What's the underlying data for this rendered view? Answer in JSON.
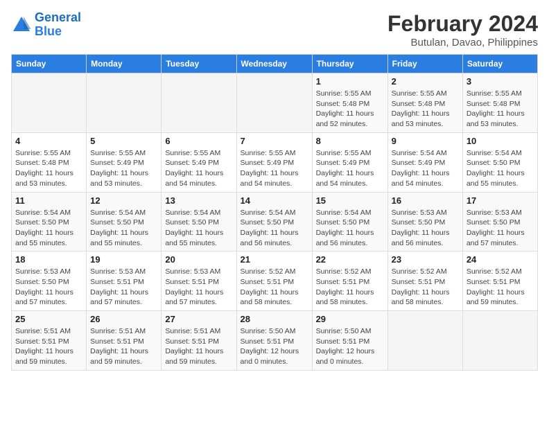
{
  "header": {
    "logo_line1": "General",
    "logo_line2": "Blue",
    "month_year": "February 2024",
    "location": "Butulan, Davao, Philippines"
  },
  "weekdays": [
    "Sunday",
    "Monday",
    "Tuesday",
    "Wednesday",
    "Thursday",
    "Friday",
    "Saturday"
  ],
  "weeks": [
    [
      {
        "day": "",
        "detail": ""
      },
      {
        "day": "",
        "detail": ""
      },
      {
        "day": "",
        "detail": ""
      },
      {
        "day": "",
        "detail": ""
      },
      {
        "day": "1",
        "detail": "Sunrise: 5:55 AM\nSunset: 5:48 PM\nDaylight: 11 hours\nand 52 minutes."
      },
      {
        "day": "2",
        "detail": "Sunrise: 5:55 AM\nSunset: 5:48 PM\nDaylight: 11 hours\nand 53 minutes."
      },
      {
        "day": "3",
        "detail": "Sunrise: 5:55 AM\nSunset: 5:48 PM\nDaylight: 11 hours\nand 53 minutes."
      }
    ],
    [
      {
        "day": "4",
        "detail": "Sunrise: 5:55 AM\nSunset: 5:48 PM\nDaylight: 11 hours\nand 53 minutes."
      },
      {
        "day": "5",
        "detail": "Sunrise: 5:55 AM\nSunset: 5:49 PM\nDaylight: 11 hours\nand 53 minutes."
      },
      {
        "day": "6",
        "detail": "Sunrise: 5:55 AM\nSunset: 5:49 PM\nDaylight: 11 hours\nand 54 minutes."
      },
      {
        "day": "7",
        "detail": "Sunrise: 5:55 AM\nSunset: 5:49 PM\nDaylight: 11 hours\nand 54 minutes."
      },
      {
        "day": "8",
        "detail": "Sunrise: 5:55 AM\nSunset: 5:49 PM\nDaylight: 11 hours\nand 54 minutes."
      },
      {
        "day": "9",
        "detail": "Sunrise: 5:54 AM\nSunset: 5:49 PM\nDaylight: 11 hours\nand 54 minutes."
      },
      {
        "day": "10",
        "detail": "Sunrise: 5:54 AM\nSunset: 5:50 PM\nDaylight: 11 hours\nand 55 minutes."
      }
    ],
    [
      {
        "day": "11",
        "detail": "Sunrise: 5:54 AM\nSunset: 5:50 PM\nDaylight: 11 hours\nand 55 minutes."
      },
      {
        "day": "12",
        "detail": "Sunrise: 5:54 AM\nSunset: 5:50 PM\nDaylight: 11 hours\nand 55 minutes."
      },
      {
        "day": "13",
        "detail": "Sunrise: 5:54 AM\nSunset: 5:50 PM\nDaylight: 11 hours\nand 55 minutes."
      },
      {
        "day": "14",
        "detail": "Sunrise: 5:54 AM\nSunset: 5:50 PM\nDaylight: 11 hours\nand 56 minutes."
      },
      {
        "day": "15",
        "detail": "Sunrise: 5:54 AM\nSunset: 5:50 PM\nDaylight: 11 hours\nand 56 minutes."
      },
      {
        "day": "16",
        "detail": "Sunrise: 5:53 AM\nSunset: 5:50 PM\nDaylight: 11 hours\nand 56 minutes."
      },
      {
        "day": "17",
        "detail": "Sunrise: 5:53 AM\nSunset: 5:50 PM\nDaylight: 11 hours\nand 57 minutes."
      }
    ],
    [
      {
        "day": "18",
        "detail": "Sunrise: 5:53 AM\nSunset: 5:50 PM\nDaylight: 11 hours\nand 57 minutes."
      },
      {
        "day": "19",
        "detail": "Sunrise: 5:53 AM\nSunset: 5:51 PM\nDaylight: 11 hours\nand 57 minutes."
      },
      {
        "day": "20",
        "detail": "Sunrise: 5:53 AM\nSunset: 5:51 PM\nDaylight: 11 hours\nand 57 minutes."
      },
      {
        "day": "21",
        "detail": "Sunrise: 5:52 AM\nSunset: 5:51 PM\nDaylight: 11 hours\nand 58 minutes."
      },
      {
        "day": "22",
        "detail": "Sunrise: 5:52 AM\nSunset: 5:51 PM\nDaylight: 11 hours\nand 58 minutes."
      },
      {
        "day": "23",
        "detail": "Sunrise: 5:52 AM\nSunset: 5:51 PM\nDaylight: 11 hours\nand 58 minutes."
      },
      {
        "day": "24",
        "detail": "Sunrise: 5:52 AM\nSunset: 5:51 PM\nDaylight: 11 hours\nand 59 minutes."
      }
    ],
    [
      {
        "day": "25",
        "detail": "Sunrise: 5:51 AM\nSunset: 5:51 PM\nDaylight: 11 hours\nand 59 minutes."
      },
      {
        "day": "26",
        "detail": "Sunrise: 5:51 AM\nSunset: 5:51 PM\nDaylight: 11 hours\nand 59 minutes."
      },
      {
        "day": "27",
        "detail": "Sunrise: 5:51 AM\nSunset: 5:51 PM\nDaylight: 11 hours\nand 59 minutes."
      },
      {
        "day": "28",
        "detail": "Sunrise: 5:50 AM\nSunset: 5:51 PM\nDaylight: 12 hours\nand 0 minutes."
      },
      {
        "day": "29",
        "detail": "Sunrise: 5:50 AM\nSunset: 5:51 PM\nDaylight: 12 hours\nand 0 minutes."
      },
      {
        "day": "",
        "detail": ""
      },
      {
        "day": "",
        "detail": ""
      }
    ]
  ]
}
